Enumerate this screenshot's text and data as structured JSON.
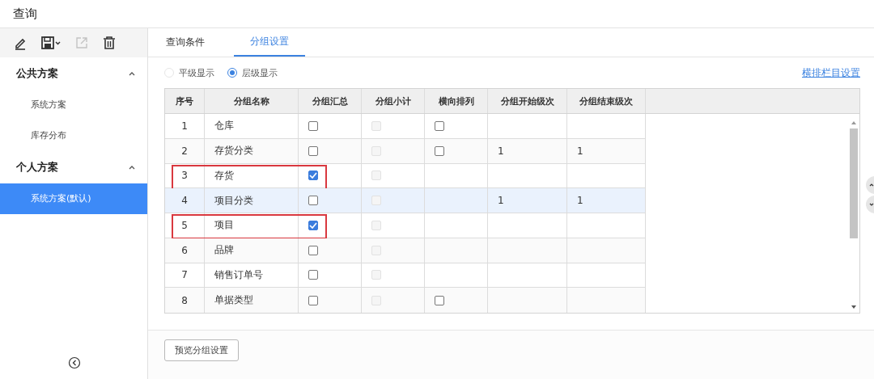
{
  "window": {
    "title": "查询"
  },
  "toolbar": [
    {
      "kind": "edit",
      "disabled": false
    },
    {
      "kind": "save",
      "disabled": false
    },
    {
      "kind": "export",
      "disabled": true
    },
    {
      "kind": "delete",
      "disabled": false
    }
  ],
  "sidebar": {
    "groups": [
      {
        "label": "公共方案",
        "expanded": true,
        "items": [
          {
            "label": "系统方案",
            "selected": false
          },
          {
            "label": "库存分布",
            "selected": false
          }
        ]
      },
      {
        "label": "个人方案",
        "expanded": true,
        "items": [
          {
            "label": "系统方案(默认)",
            "selected": true
          }
        ]
      }
    ]
  },
  "tabs": [
    {
      "label": "查询条件",
      "selected": false
    },
    {
      "label": "分组设置",
      "selected": true
    }
  ],
  "display_modes": [
    {
      "label": "平级显示",
      "selected": false
    },
    {
      "label": "层级显示",
      "selected": true
    }
  ],
  "link": "横排栏目设置",
  "table": {
    "columns": [
      "序号",
      "分组名称",
      "分组汇总",
      "分组小计",
      "横向排列",
      "分组开始级次",
      "分组结束级次"
    ],
    "rows": [
      {
        "no": "1",
        "name": "仓库",
        "summary_checked": false,
        "subtotal_disabled": true,
        "horizontal_checked": false,
        "start": "",
        "end": "",
        "selected": false,
        "highlighted": false
      },
      {
        "no": "2",
        "name": "存货分类",
        "summary_checked": false,
        "subtotal_disabled": true,
        "horizontal_checked": false,
        "start": "1",
        "end": "1",
        "selected": false,
        "highlighted": false
      },
      {
        "no": "3",
        "name": "存货",
        "summary_checked": true,
        "subtotal_disabled": true,
        "start": "",
        "end": "",
        "selected": false,
        "highlighted": true
      },
      {
        "no": "4",
        "name": "项目分类",
        "summary_checked": false,
        "subtotal_disabled": true,
        "start": "1",
        "end": "1",
        "selected": true,
        "highlighted": false
      },
      {
        "no": "5",
        "name": "项目",
        "summary_checked": true,
        "subtotal_disabled": true,
        "start": "",
        "end": "",
        "selected": false,
        "highlighted": true
      },
      {
        "no": "6",
        "name": "品牌",
        "summary_checked": false,
        "subtotal_disabled": true,
        "start": "",
        "end": "",
        "selected": false,
        "highlighted": false
      },
      {
        "no": "7",
        "name": "销售订单号",
        "summary_checked": false,
        "subtotal_disabled": true,
        "start": "",
        "end": "",
        "selected": false,
        "highlighted": false
      },
      {
        "no": "8",
        "name": "单据类型",
        "summary_checked": false,
        "subtotal_disabled": true,
        "horizontal_checked": false,
        "start": "",
        "end": "",
        "selected": false,
        "highlighted": false
      }
    ]
  },
  "preview_button": "预览分组设置"
}
